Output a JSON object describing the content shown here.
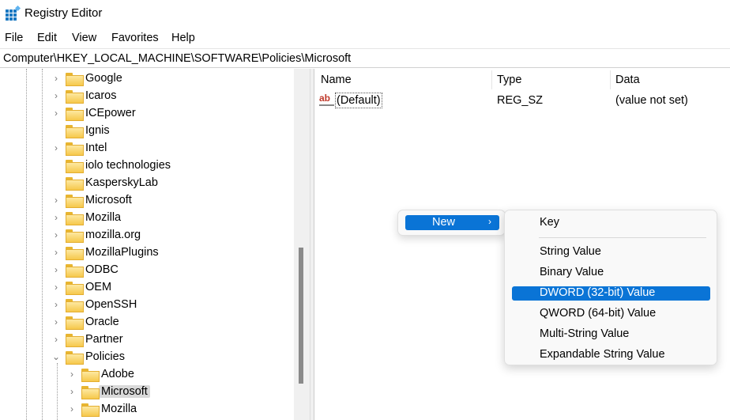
{
  "window": {
    "title": "Registry Editor"
  },
  "menubar": [
    "File",
    "Edit",
    "View",
    "Favorites",
    "Help"
  ],
  "address": "Computer\\HKEY_LOCAL_MACHINE\\SOFTWARE\\Policies\\Microsoft",
  "tree": [
    {
      "label": "Google",
      "arrow": "›"
    },
    {
      "label": "Icaros",
      "arrow": "›"
    },
    {
      "label": "ICEpower",
      "arrow": "›"
    },
    {
      "label": "Ignis",
      "arrow": ""
    },
    {
      "label": "Intel",
      "arrow": "›"
    },
    {
      "label": "iolo technologies",
      "arrow": ""
    },
    {
      "label": "KasperskyLab",
      "arrow": ""
    },
    {
      "label": "Microsoft",
      "arrow": "›"
    },
    {
      "label": "Mozilla",
      "arrow": "›"
    },
    {
      "label": "mozilla.org",
      "arrow": "›"
    },
    {
      "label": "MozillaPlugins",
      "arrow": "›"
    },
    {
      "label": "ODBC",
      "arrow": "›"
    },
    {
      "label": "OEM",
      "arrow": "›"
    },
    {
      "label": "OpenSSH",
      "arrow": "›"
    },
    {
      "label": "Oracle",
      "arrow": "›"
    },
    {
      "label": "Partner",
      "arrow": "›"
    },
    {
      "label": "Policies",
      "arrow": "⌄"
    }
  ],
  "tree_children": [
    {
      "label": "Adobe"
    },
    {
      "label": "Microsoft",
      "selected": true
    },
    {
      "label": "Mozilla"
    }
  ],
  "list": {
    "headers": [
      "Name",
      "Type",
      "Data"
    ],
    "rows": [
      {
        "name": "(Default)",
        "type": "REG_SZ",
        "data": "(value not set)"
      }
    ]
  },
  "context_menu": {
    "new_label": "New",
    "submenu": [
      "Key",
      "String Value",
      "Binary Value",
      "DWORD (32-bit) Value",
      "QWORD (64-bit) Value",
      "Multi-String Value",
      "Expandable String Value"
    ],
    "highlighted": "DWORD (32-bit) Value"
  },
  "colors": {
    "accent": "#0a74d6"
  }
}
